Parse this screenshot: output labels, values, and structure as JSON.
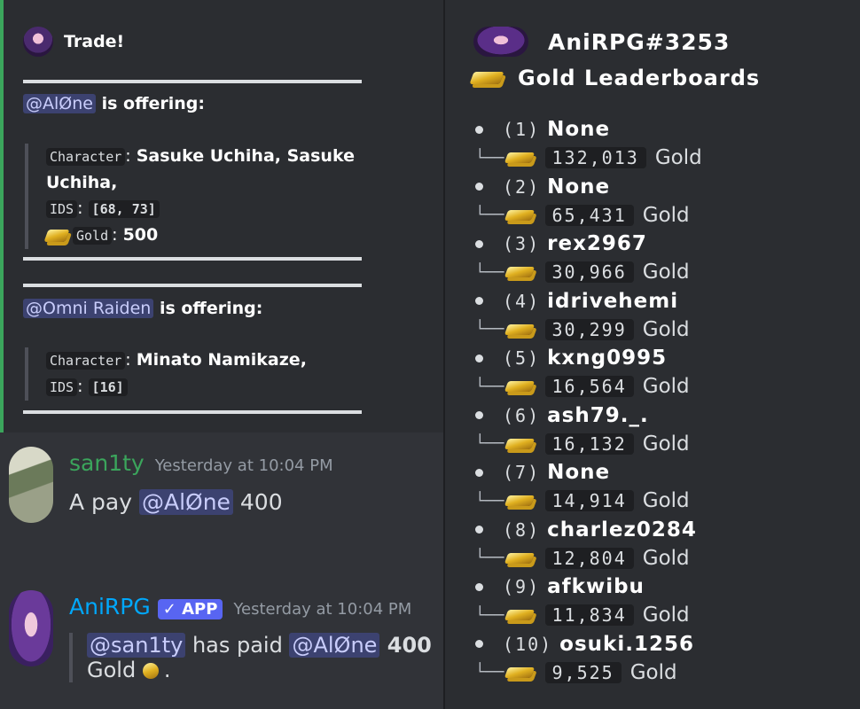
{
  "trade": {
    "title": "Trade!",
    "offer1": {
      "mention": "@AlØne",
      "text": " is offering:",
      "character_label": "Character",
      "character_value": "Sasuke Uchiha, Sasuke Uchiha,",
      "ids_label": "IDS",
      "ids_value": "[68, 73]",
      "gold_label": "Gold",
      "gold_value": "500"
    },
    "offer2": {
      "mention": "@Omni Raiden",
      "text": " is offering:",
      "character_label": "Character",
      "character_value": "Minato Namikaze,",
      "ids_label": "IDS",
      "ids_value": "[16]"
    }
  },
  "chat": {
    "msg1": {
      "username": "san1ty",
      "username_color": "#3ba55c",
      "timestamp": "Yesterday at 10:04 PM",
      "text_before": "A pay ",
      "mention": "@AlØne",
      "text_after": " 400"
    },
    "msg2": {
      "username": "AniRPG",
      "username_color": "#00a8fc",
      "badge": "✓ APP",
      "timestamp": "Yesterday at 10:04 PM",
      "mention1": "@san1ty",
      "text_mid": " has paid ",
      "mention2": "@AlØne",
      "amount": " 400",
      "text_after": " Gold",
      "end": "."
    }
  },
  "leaderboard": {
    "bot_name": "AniRPG#3253",
    "title": "Gold Leaderboards",
    "gold_word": "Gold",
    "entries": [
      {
        "rank": "(1)",
        "name": "None",
        "gold": "132,013"
      },
      {
        "rank": "(2)",
        "name": "None",
        "gold": "65,431"
      },
      {
        "rank": "(3)",
        "name": "rex2967",
        "gold": "30,966"
      },
      {
        "rank": "(4)",
        "name": "idrivehemi",
        "gold": "30,299"
      },
      {
        "rank": "(5)",
        "name": "kxng0995",
        "gold": "16,564"
      },
      {
        "rank": "(6)",
        "name": "ash79._.",
        "gold": "16,132"
      },
      {
        "rank": "(7)",
        "name": "None",
        "gold": "14,914"
      },
      {
        "rank": "(8)",
        "name": "charlez0284",
        "gold": "12,804"
      },
      {
        "rank": "(9)",
        "name": "afkwibu",
        "gold": "11,834"
      },
      {
        "rank": "(10)",
        "name": "osuki.1256",
        "gold": "9,525"
      }
    ]
  }
}
